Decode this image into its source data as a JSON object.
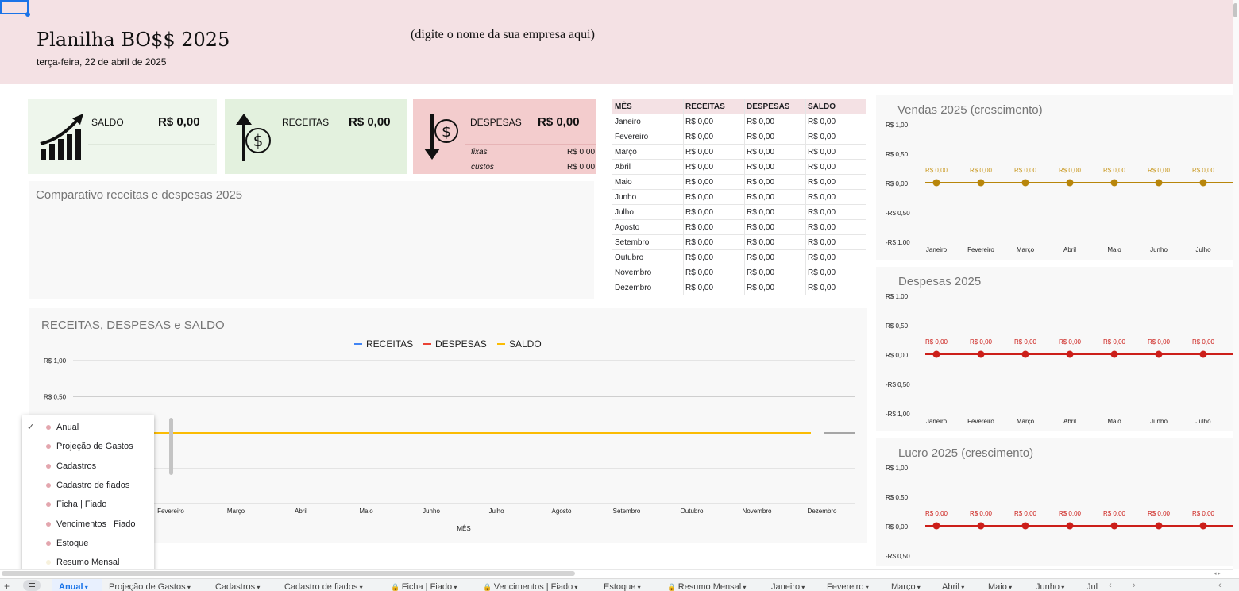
{
  "header": {
    "title": "Planilha BO$$ 2025",
    "date": "terça-feira, 22 de abril de 2025",
    "company_placeholder": "(digite o nome da sua empresa aqui)"
  },
  "cards": {
    "saldo": {
      "label": "SALDO",
      "value": "R$ 0,00"
    },
    "receitas": {
      "label": "RECEITAS",
      "value": "R$ 0,00"
    },
    "despesas": {
      "label": "DESPESAS",
      "value": "R$ 0,00",
      "fixas_label": "fixas",
      "fixas_value": "R$ 0,00",
      "custos_label": "custos",
      "custos_value": "R$ 0,00"
    }
  },
  "table": {
    "headers": [
      "MÊS",
      "RECEITAS",
      "DESPESAS",
      "SALDO"
    ],
    "rows": [
      [
        "Janeiro",
        "R$ 0,00",
        "R$ 0,00",
        "R$ 0,00"
      ],
      [
        "Fevereiro",
        "R$ 0,00",
        "R$ 0,00",
        "R$ 0,00"
      ],
      [
        "Março",
        "R$ 0,00",
        "R$ 0,00",
        "R$ 0,00"
      ],
      [
        "Abril",
        "R$ 0,00",
        "R$ 0,00",
        "R$ 0,00"
      ],
      [
        "Maio",
        "R$ 0,00",
        "R$ 0,00",
        "R$ 0,00"
      ],
      [
        "Junho",
        "R$ 0,00",
        "R$ 0,00",
        "R$ 0,00"
      ],
      [
        "Julho",
        "R$ 0,00",
        "R$ 0,00",
        "R$ 0,00"
      ],
      [
        "Agosto",
        "R$ 0,00",
        "R$ 0,00",
        "R$ 0,00"
      ],
      [
        "Setembro",
        "R$ 0,00",
        "R$ 0,00",
        "R$ 0,00"
      ],
      [
        "Outubro",
        "R$ 0,00",
        "R$ 0,00",
        "R$ 0,00"
      ],
      [
        "Novembro",
        "R$ 0,00",
        "R$ 0,00",
        "R$ 0,00"
      ],
      [
        "Dezembro",
        "R$ 0,00",
        "R$ 0,00",
        "R$ 0,00"
      ]
    ]
  },
  "comparativo": {
    "title": "Comparativo receitas e despesas 2025"
  },
  "main_chart": {
    "title": "RECEITAS, DESPESAS e SALDO",
    "xlabel": "MÊS",
    "ytick_labels": [
      "R$ 1,00",
      "R$ 0,50"
    ],
    "x_labels": [
      "Fevereiro",
      "Março",
      "Abril",
      "Maio",
      "Junho",
      "Julho",
      "Agosto",
      "Setembro",
      "Outubro",
      "Novembro",
      "Dezembro"
    ],
    "legend": [
      {
        "name": "RECEITAS",
        "color": "#4285f4"
      },
      {
        "name": "DESPESAS",
        "color": "#ea4335"
      },
      {
        "name": "SALDO",
        "color": "#fbbc04"
      }
    ]
  },
  "side_charts": [
    {
      "title": "Vendas 2025 (crescimento)",
      "color": "#b8860b",
      "label_color": "#c8961a",
      "yticks": [
        "R$ 1,00",
        "R$ 0,50",
        "R$ 0,00",
        "-R$ 0,50",
        "-R$ 1,00"
      ],
      "months": [
        "Janeiro",
        "Fevereiro",
        "Março",
        "Abril",
        "Maio",
        "Junho",
        "Julho"
      ],
      "labels": [
        "R$ 0,00",
        "R$ 0,00",
        "R$ 0,00",
        "R$ 0,00",
        "R$ 0,00",
        "R$ 0,00",
        "R$ 0,00"
      ]
    },
    {
      "title": "Despesas 2025",
      "color": "#cc1f1a",
      "label_color": "#cc1f1a",
      "yticks": [
        "R$ 1,00",
        "R$ 0,50",
        "R$ 0,00",
        "-R$ 0,50",
        "-R$ 1,00"
      ],
      "months": [
        "Janeiro",
        "Fevereiro",
        "Março",
        "Abril",
        "Maio",
        "Junho",
        "Julho"
      ],
      "labels": [
        "R$ 0,00",
        "R$ 0,00",
        "R$ 0,00",
        "R$ 0,00",
        "R$ 0,00",
        "R$ 0,00",
        "R$ 0,00"
      ]
    },
    {
      "title": "Lucro 2025 (crescimento)",
      "color": "#cc1f1a",
      "label_color": "#cc1f1a",
      "yticks": [
        "R$ 1,00",
        "R$ 0,50",
        "R$ 0,00",
        "-R$ 0,50"
      ],
      "months": [],
      "labels": [
        "R$ 0,00",
        "R$ 0,00",
        "R$ 0,00",
        "R$ 0,00",
        "R$ 0,00",
        "R$ 0,00",
        "R$ 0,00"
      ]
    }
  ],
  "chart_data": [
    {
      "type": "line",
      "title": "RECEITAS, DESPESAS e SALDO",
      "xlabel": "MÊS",
      "categories": [
        "Fevereiro",
        "Março",
        "Abril",
        "Maio",
        "Junho",
        "Julho",
        "Agosto",
        "Setembro",
        "Outubro",
        "Novembro",
        "Dezembro"
      ],
      "series": [
        {
          "name": "RECEITAS",
          "values": [
            0,
            0,
            0,
            0,
            0,
            0,
            0,
            0,
            0,
            0,
            0
          ]
        },
        {
          "name": "DESPESAS",
          "values": [
            0,
            0,
            0,
            0,
            0,
            0,
            0,
            0,
            0,
            0,
            0
          ]
        },
        {
          "name": "SALDO",
          "values": [
            0,
            0,
            0,
            0,
            0,
            0,
            0,
            0,
            0,
            0,
            0
          ]
        }
      ]
    },
    {
      "type": "line",
      "title": "Vendas 2025 (crescimento)",
      "ylim": [
        -1,
        1
      ],
      "categories": [
        "Janeiro",
        "Fevereiro",
        "Março",
        "Abril",
        "Maio",
        "Junho",
        "Julho"
      ],
      "values": [
        0,
        0,
        0,
        0,
        0,
        0,
        0
      ]
    },
    {
      "type": "line",
      "title": "Despesas 2025",
      "ylim": [
        -1,
        1
      ],
      "categories": [
        "Janeiro",
        "Fevereiro",
        "Março",
        "Abril",
        "Maio",
        "Junho",
        "Julho"
      ],
      "values": [
        0,
        0,
        0,
        0,
        0,
        0,
        0
      ]
    },
    {
      "type": "line",
      "title": "Lucro 2025 (crescimento)",
      "ylim": [
        -1,
        1
      ],
      "values": [
        0,
        0,
        0,
        0,
        0,
        0,
        0
      ]
    }
  ],
  "sheet_menu": {
    "items": [
      {
        "label": "Anual",
        "checked": true,
        "color": "#e3a6ae"
      },
      {
        "label": "Projeção de Gastos",
        "checked": false,
        "color": "#e3a6ae"
      },
      {
        "label": "Cadastros",
        "checked": false,
        "color": "#e3a6ae"
      },
      {
        "label": "Cadastro de fiados",
        "checked": false,
        "color": "#e3a6ae"
      },
      {
        "label": "Ficha | Fiado",
        "checked": false,
        "color": "#e3a6ae"
      },
      {
        "label": "Vencimentos | Fiado",
        "checked": false,
        "color": "#e3a6ae"
      },
      {
        "label": "Estoque",
        "checked": false,
        "color": "#e3a6ae"
      },
      {
        "label": "Resumo Mensal",
        "checked": false,
        "color": "#f7f1dc"
      }
    ]
  },
  "tabs": [
    {
      "label": "Anual",
      "locked": false,
      "active": true
    },
    {
      "label": "Projeção de Gastos",
      "locked": false
    },
    {
      "label": "Cadastros",
      "locked": false
    },
    {
      "label": "Cadastro de fiados",
      "locked": false
    },
    {
      "label": "Ficha | Fiado",
      "locked": true
    },
    {
      "label": "Vencimentos | Fiado",
      "locked": true
    },
    {
      "label": "Estoque",
      "locked": false
    },
    {
      "label": "Resumo Mensal",
      "locked": true
    },
    {
      "label": "Janeiro",
      "locked": false
    },
    {
      "label": "Fevereiro",
      "locked": false
    },
    {
      "label": "Março",
      "locked": false
    },
    {
      "label": "Abril",
      "locked": false
    },
    {
      "label": "Maio",
      "locked": false
    },
    {
      "label": "Junho",
      "locked": false
    },
    {
      "label": "Jul",
      "locked": false
    }
  ]
}
